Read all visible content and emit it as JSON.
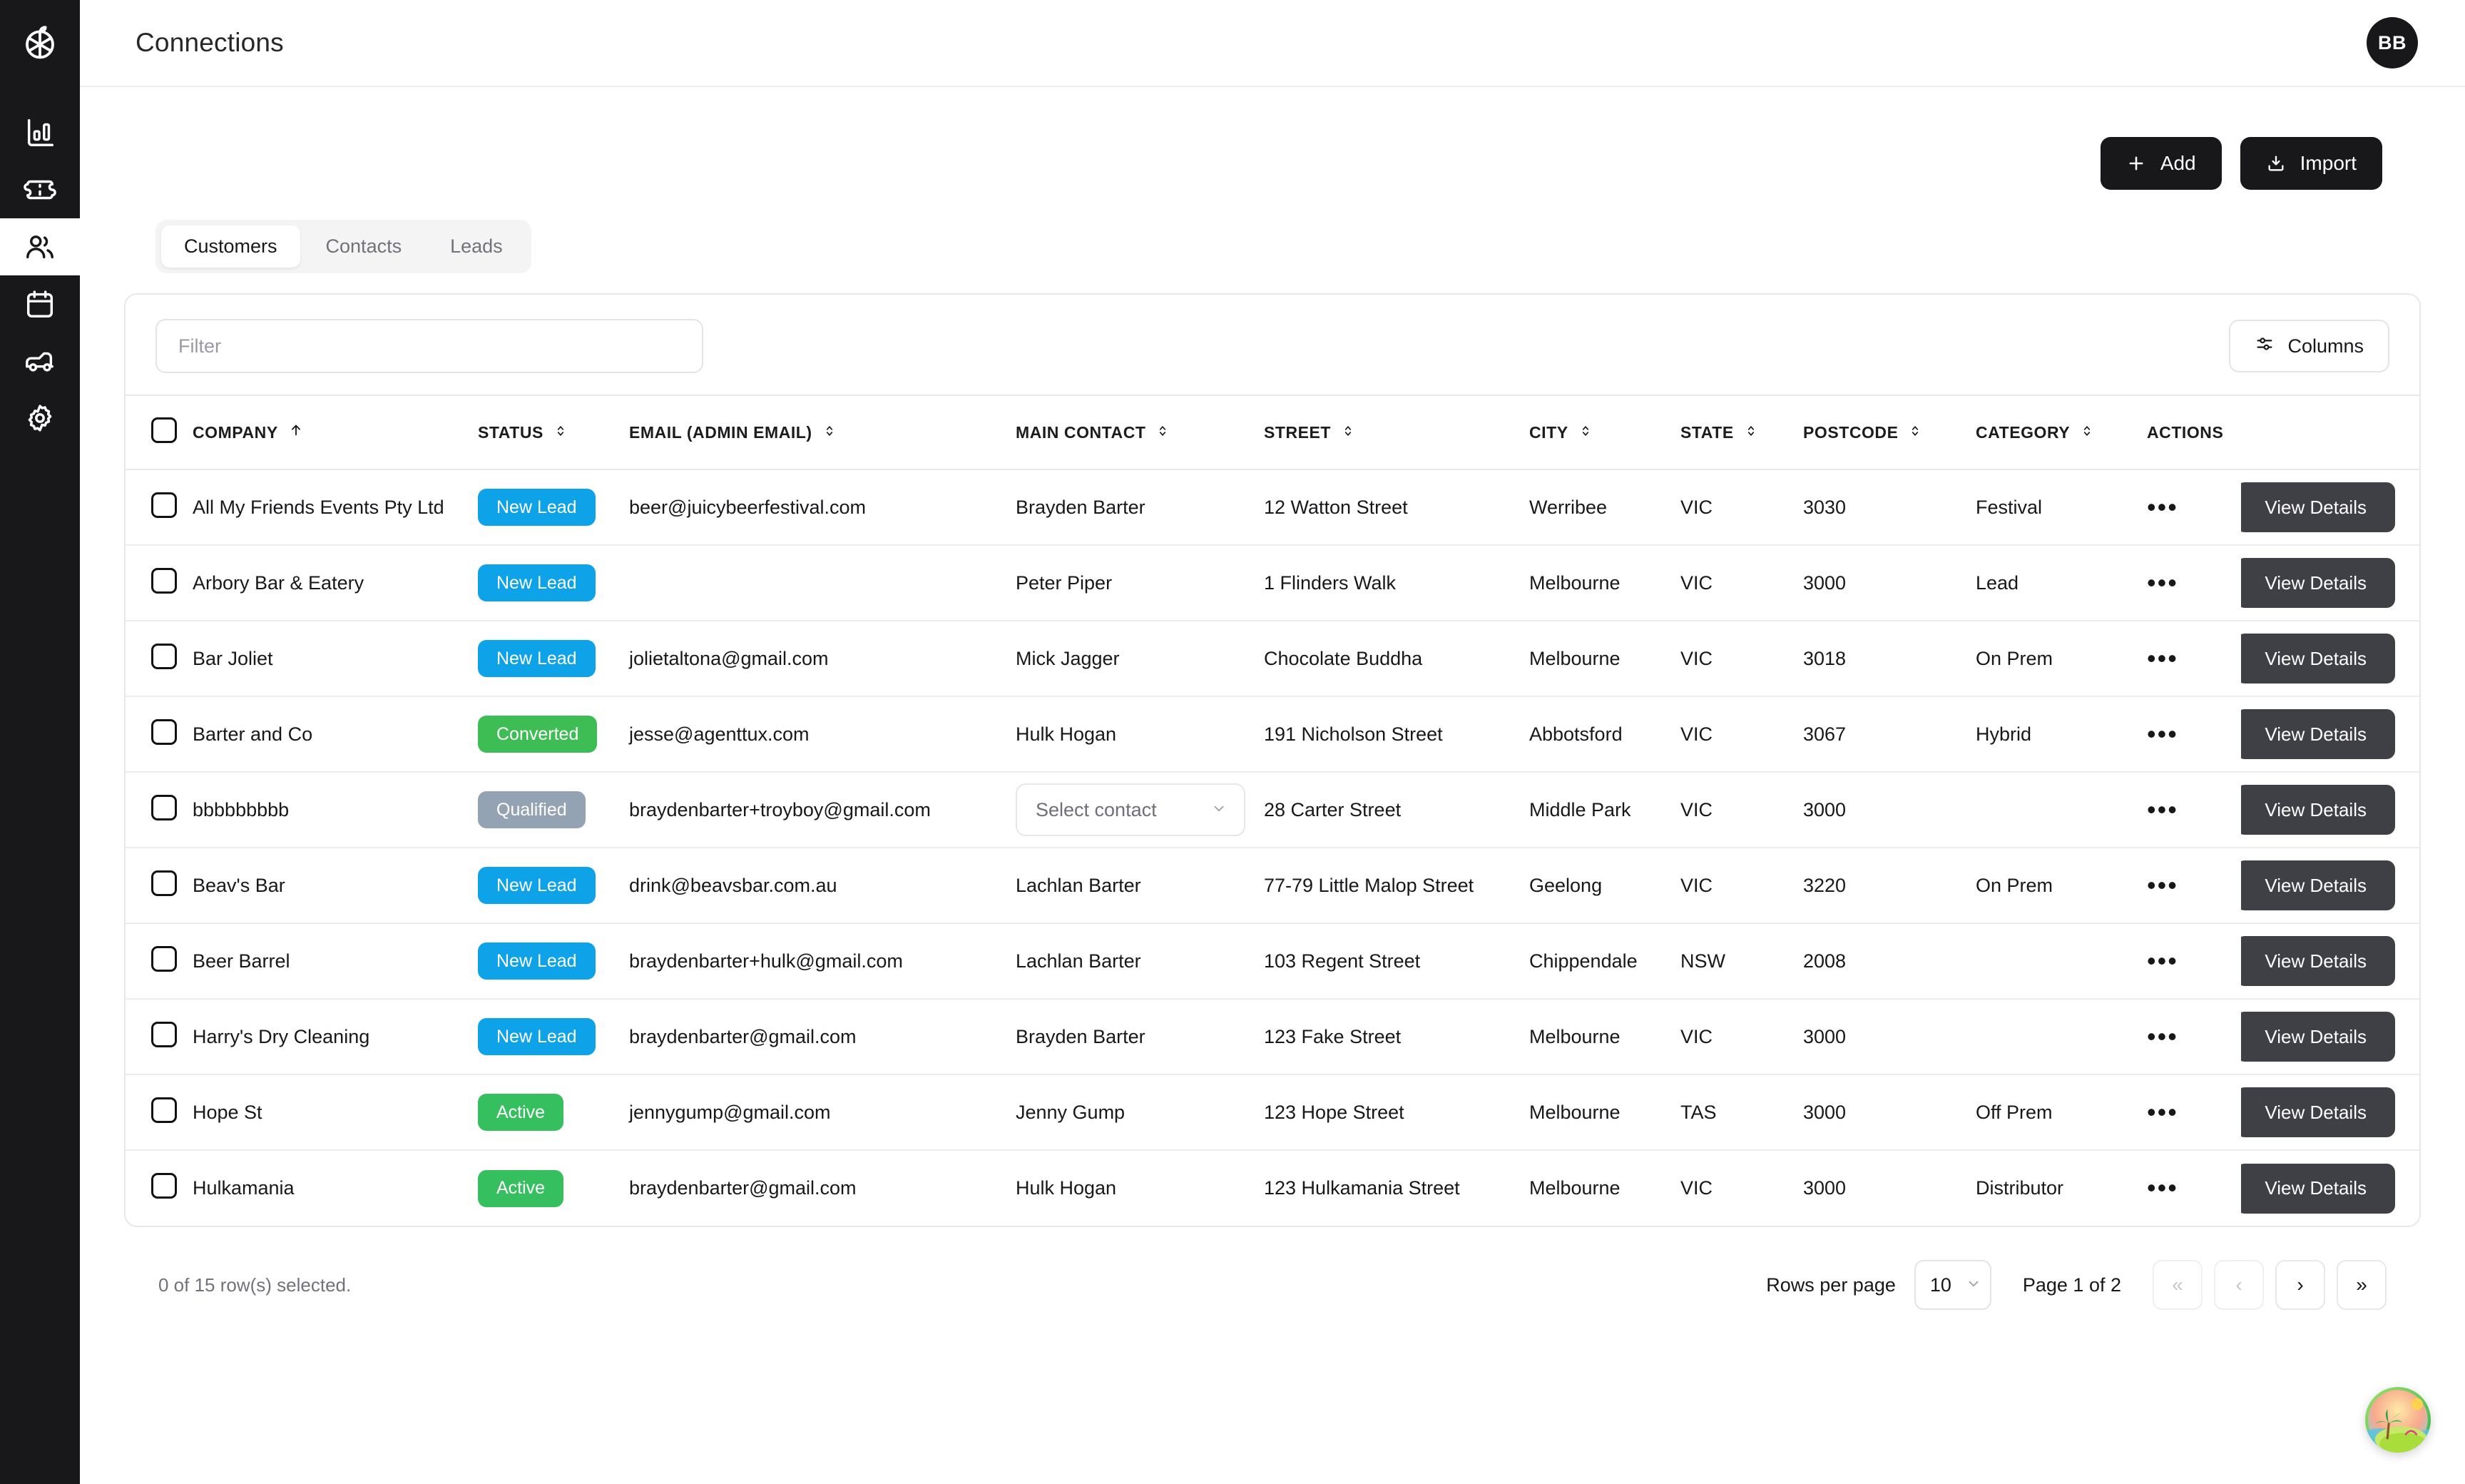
{
  "header": {
    "title": "Connections",
    "avatar_initials": "BB"
  },
  "sidebar": {
    "logo_name": "citrus-logo-icon",
    "items": [
      {
        "name": "analytics",
        "icon": "bar-chart-icon",
        "active": false
      },
      {
        "name": "tickets",
        "icon": "ticket-icon",
        "active": false
      },
      {
        "name": "connections",
        "icon": "users-icon",
        "active": true
      },
      {
        "name": "calendar",
        "icon": "calendar-icon",
        "active": false
      },
      {
        "name": "deliveries",
        "icon": "van-icon",
        "active": false
      },
      {
        "name": "settings",
        "icon": "gear-icon",
        "active": false
      }
    ]
  },
  "toolbar": {
    "add_label": "Add",
    "import_label": "Import"
  },
  "tabs": [
    {
      "label": "Customers",
      "active": true
    },
    {
      "label": "Contacts",
      "active": false
    },
    {
      "label": "Leads",
      "active": false
    }
  ],
  "filter": {
    "value": "",
    "placeholder": "Filter"
  },
  "columns_button": {
    "label": "Columns"
  },
  "table": {
    "headers": [
      {
        "label": "COMPANY",
        "sort": "asc"
      },
      {
        "label": "STATUS",
        "sort": "none"
      },
      {
        "label": "EMAIL (ADMIN EMAIL)",
        "sort": "none"
      },
      {
        "label": "MAIN CONTACT",
        "sort": "none"
      },
      {
        "label": "STREET",
        "sort": "none"
      },
      {
        "label": "CITY",
        "sort": "none"
      },
      {
        "label": "STATE",
        "sort": "none"
      },
      {
        "label": "POSTCODE",
        "sort": "none"
      },
      {
        "label": "CATEGORY",
        "sort": "none"
      },
      {
        "label": "ACTIONS",
        "sort": ""
      }
    ],
    "view_details_label": "View Details",
    "select_contact_placeholder": "Select contact",
    "status_colors": {
      "New Lead": "#0ea2e9",
      "Converted": "#3fbd55",
      "Qualified": "#94a3b4",
      "Active": "#35bf5f"
    },
    "rows": [
      {
        "company": "All My Friends Events Pty Ltd",
        "status": "New Lead",
        "email": "beer@juicybeerfestival.com",
        "contact": "Brayden Barter",
        "contact_is_select": false,
        "street": "12 Watton Street",
        "city": "Werribee",
        "state": "VIC",
        "postcode": "3030",
        "category": "Festival"
      },
      {
        "company": "Arbory Bar & Eatery",
        "status": "New Lead",
        "email": "",
        "contact": "Peter Piper",
        "contact_is_select": false,
        "street": "1 Flinders Walk",
        "city": "Melbourne",
        "state": "VIC",
        "postcode": "3000",
        "category": "Lead"
      },
      {
        "company": "Bar Joliet",
        "status": "New Lead",
        "email": "jolietaltona@gmail.com",
        "contact": "Mick Jagger",
        "contact_is_select": false,
        "street": "Chocolate Buddha",
        "city": "Melbourne",
        "state": "VIC",
        "postcode": "3018",
        "category": "On Prem"
      },
      {
        "company": "Barter and Co",
        "status": "Converted",
        "email": "jesse@agenttux.com",
        "contact": "Hulk Hogan",
        "contact_is_select": false,
        "street": "191 Nicholson Street",
        "city": "Abbotsford",
        "state": "VIC",
        "postcode": "3067",
        "category": "Hybrid"
      },
      {
        "company": "bbbbbbbbb",
        "status": "Qualified",
        "email": "braydenbarter+troyboy@gmail.com",
        "contact": "",
        "contact_is_select": true,
        "street": "28 Carter Street",
        "city": "Middle Park",
        "state": "VIC",
        "postcode": "3000",
        "category": ""
      },
      {
        "company": "Beav's Bar",
        "status": "New Lead",
        "email": "drink@beavsbar.com.au",
        "contact": "Lachlan Barter",
        "contact_is_select": false,
        "street": "77-79 Little Malop Street",
        "city": "Geelong",
        "state": "VIC",
        "postcode": "3220",
        "category": "On Prem"
      },
      {
        "company": "Beer Barrel",
        "status": "New Lead",
        "email": "braydenbarter+hulk@gmail.com",
        "contact": "Lachlan Barter",
        "contact_is_select": false,
        "street": "103 Regent Street",
        "city": "Chippendale",
        "state": "NSW",
        "postcode": "2008",
        "category": ""
      },
      {
        "company": "Harry's Dry Cleaning",
        "status": "New Lead",
        "email": "braydenbarter@gmail.com",
        "contact": "Brayden Barter",
        "contact_is_select": false,
        "street": "123 Fake Street",
        "city": "Melbourne",
        "state": "VIC",
        "postcode": "3000",
        "category": ""
      },
      {
        "company": "Hope St",
        "status": "Active",
        "email": "jennygump@gmail.com",
        "contact": "Jenny Gump",
        "contact_is_select": false,
        "street": "123 Hope Street",
        "city": "Melbourne",
        "state": "TAS",
        "postcode": "3000",
        "category": "Off Prem"
      },
      {
        "company": "Hulkamania",
        "status": "Active",
        "email": "braydenbarter@gmail.com",
        "contact": "Hulk Hogan",
        "contact_is_select": false,
        "street": "123 Hulkamania Street",
        "city": "Melbourne",
        "state": "VIC",
        "postcode": "3000",
        "category": "Distributor"
      }
    ]
  },
  "footer": {
    "selection_text": "0 of 15 row(s) selected.",
    "rows_per_page_label": "Rows per page",
    "rows_per_page_value": "10",
    "page_label": "Page 1 of 2",
    "first_page_label": "«",
    "prev_page_label": "‹",
    "next_page_label": "›",
    "last_page_label": "»"
  }
}
